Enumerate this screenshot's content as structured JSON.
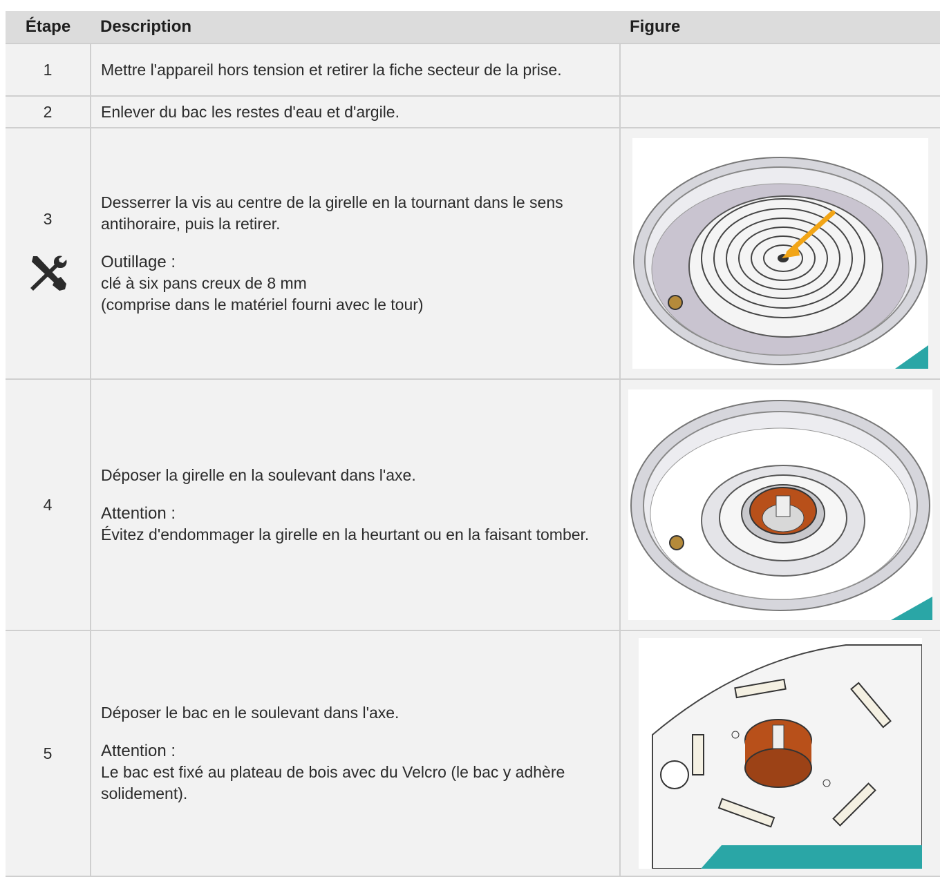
{
  "header": {
    "step": "Étape",
    "description": "Description",
    "figure": "Figure"
  },
  "rows": [
    {
      "step": "1",
      "text": "Mettre l'appareil hors tension et retirer la fiche secteur de la prise."
    },
    {
      "step": "2",
      "text": "Enlever du bac les restes d'eau et d'argile."
    },
    {
      "step": "3",
      "text": "Desserrer la vis au centre de la girelle en la tournant dans le sens antihoraire, puis la retirer.",
      "note_title": "Outillage :",
      "note_line1": "clé à six pans creux de 8 mm",
      "note_line2": "(comprise dans le matériel fourni avec le tour)",
      "icon": "wrench-screwdriver-icon"
    },
    {
      "step": "4",
      "text": "Déposer la girelle en la soulevant dans l'axe.",
      "note_title": "Attention :",
      "note_line1": "Évitez d'endommager la girelle en la heurtant ou en la faisant tomber."
    },
    {
      "step": "5",
      "text": "Déposer le bac en le soulevant dans l'axe.",
      "note_title": "Attention :",
      "note_line1": "Le bac est fixé au plateau de bois avec du Velcro (le bac y adhère solidement)."
    }
  ],
  "colors": {
    "header_bg": "#dcdcdc",
    "cell_bg": "#f2f2f2",
    "arrow": "#f2a516",
    "hub": "#b8501a",
    "base": "#2aa6a6"
  }
}
